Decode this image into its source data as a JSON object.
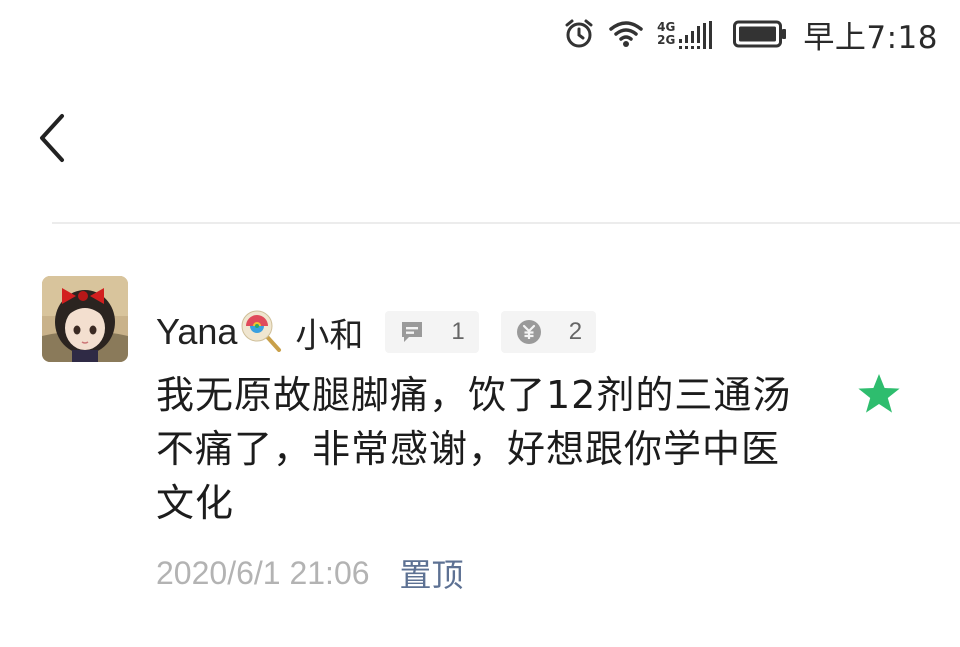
{
  "status_bar": {
    "network_top": "4G",
    "network_bottom": "2G",
    "time": "早上7:18",
    "icons": [
      "alarm-icon",
      "wifi-icon",
      "signal-icon",
      "battery-icon"
    ]
  },
  "nav": {
    "back_icon": "chevron-left-icon"
  },
  "comment": {
    "username": "Yana",
    "username_suffix": "小和",
    "reply_count": "1",
    "reward_count": "2",
    "body": "我无原故腿脚痛，饮了12剂的三通汤不痛了，非常感谢，好想跟你学中医文化",
    "timestamp": "2020/6/1 21:06",
    "pin_label": "置顶",
    "star_color": "#2ebd6e",
    "icons": [
      "lollipop-icon",
      "comment-icon",
      "reward-icon",
      "star-icon"
    ]
  }
}
